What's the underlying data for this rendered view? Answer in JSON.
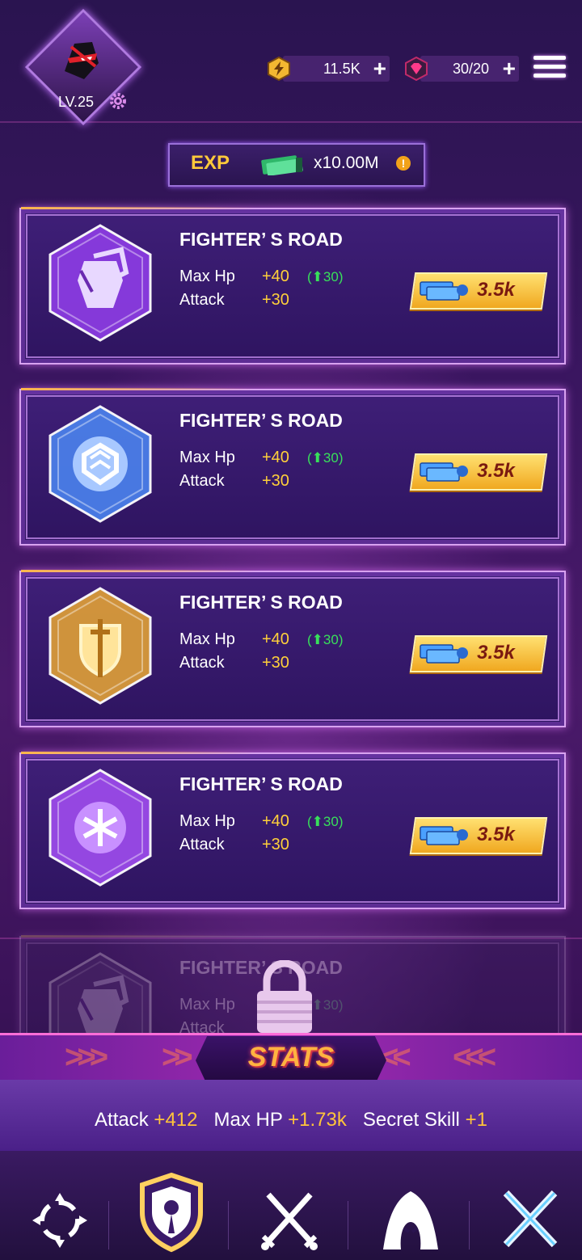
{
  "player": {
    "level": "LV.25"
  },
  "resources": {
    "energy": {
      "value": "11.5K",
      "icon": "energy-icon"
    },
    "gems": {
      "value": "30/20",
      "icon": "gem-icon"
    }
  },
  "exp": {
    "label": "EXP",
    "value": "x10.00M",
    "warning": "!"
  },
  "cards": [
    {
      "title": "FIGHTER’ S ROAD",
      "max_hp_label": "Max Hp",
      "max_hp_value": "+40",
      "max_hp_bonus": "(⬆30)",
      "attack_label": "Attack",
      "attack_value": "+30",
      "cost": "3.5k",
      "icon": "fist-emblem-icon",
      "color": "#8a3be0",
      "locked": false
    },
    {
      "title": "FIGHTER’ S ROAD",
      "max_hp_label": "Max Hp",
      "max_hp_value": "+40",
      "max_hp_bonus": "(⬆30)",
      "attack_label": "Attack",
      "attack_value": "+30",
      "cost": "3.5k",
      "icon": "shield-crest-icon",
      "color": "#4a7ee8",
      "locked": false
    },
    {
      "title": "FIGHTER’ S ROAD",
      "max_hp_label": "Max Hp",
      "max_hp_value": "+40",
      "max_hp_bonus": "(⬆30)",
      "attack_label": "Attack",
      "attack_value": "+30",
      "cost": "3.5k",
      "icon": "sword-shield-icon",
      "color": "#d89a3a",
      "locked": false
    },
    {
      "title": "FIGHTER’ S ROAD",
      "max_hp_label": "Max Hp",
      "max_hp_value": "+40",
      "max_hp_bonus": "(⬆30)",
      "attack_label": "Attack",
      "attack_value": "+30",
      "cost": "3.5k",
      "icon": "snowflake-icon",
      "color": "#9a4ae8",
      "locked": false
    },
    {
      "title": "FIGHTER’ S ROAD",
      "max_hp_label": "Max Hp",
      "max_hp_value": "+40",
      "max_hp_bonus": "(⬆30)",
      "attack_label": "Attack",
      "attack_value": "+30",
      "cost": "",
      "icon": "fist-emblem-icon",
      "color": "#5a3a8a",
      "locked": true
    }
  ],
  "stats": {
    "title": "STATS",
    "attack_label": "Attack",
    "attack_value": "+412",
    "max_hp_label": "Max HP",
    "max_hp_value": "+1.73k",
    "secret_label": "Secret Skill",
    "secret_value": "+1"
  },
  "nav": [
    "target-icon",
    "shield-icon",
    "crossed-swords-icon",
    "hood-icon",
    "crossed-blades-icon"
  ],
  "colors": {
    "accent_gold": "#ffc43a",
    "bonus_green": "#38e05a",
    "frame_pink": "#d8a2f0"
  }
}
